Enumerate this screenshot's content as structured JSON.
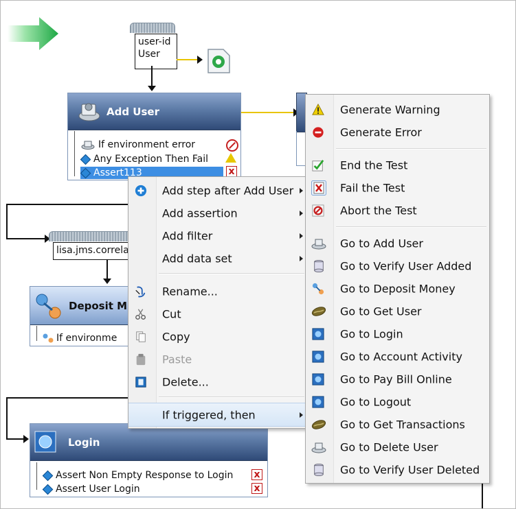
{
  "workflow": {
    "dataset_top": {
      "line1": "user-id",
      "line2": "User"
    },
    "dataset_mid": {
      "label": "lisa.jms.correla"
    },
    "add_user": {
      "title": "Add User",
      "rows": [
        "If environment error",
        "Any Exception Then Fail",
        "Assert113"
      ]
    },
    "deposit": {
      "title": "Deposit M",
      "rows": [
        "If environme"
      ]
    },
    "login": {
      "title": "Login",
      "rows": [
        "Assert Non Empty Response to Login",
        "Assert User Login"
      ]
    }
  },
  "context_menu": {
    "items": [
      {
        "label": "Add step after Add User",
        "icon": "plus-circle-icon",
        "submenu": true
      },
      {
        "label": "Add assertion",
        "icon": "",
        "submenu": true
      },
      {
        "label": "Add filter",
        "icon": "",
        "submenu": true
      },
      {
        "label": "Add data set",
        "icon": "",
        "submenu": true
      },
      {
        "label": "Rename...",
        "icon": "rename-icon",
        "submenu": false
      },
      {
        "label": "Cut",
        "icon": "scissors-icon",
        "submenu": false
      },
      {
        "label": "Copy",
        "icon": "copy-icon",
        "submenu": false
      },
      {
        "label": "Paste",
        "icon": "paste-icon",
        "submenu": false,
        "disabled": true
      },
      {
        "label": "Delete...",
        "icon": "trash-icon",
        "submenu": false
      },
      {
        "label": "If triggered, then",
        "icon": "",
        "submenu": true,
        "highlighted": true
      }
    ]
  },
  "submenu": {
    "items": [
      {
        "label": "Generate Warning",
        "icon": "warning-icon"
      },
      {
        "label": "Generate Error",
        "icon": "error-icon"
      },
      {
        "label": "End the Test",
        "icon": "check-icon"
      },
      {
        "label": "Fail the Test",
        "icon": "fail-icon"
      },
      {
        "label": "Abort the Test",
        "icon": "abort-icon"
      },
      {
        "label": "Go to Add User",
        "icon": "step-icon"
      },
      {
        "label": "Go to Verify User Added",
        "icon": "db-icon"
      },
      {
        "label": "Go to Deposit Money",
        "icon": "deposit-icon"
      },
      {
        "label": "Go to Get User",
        "icon": "bean-icon"
      },
      {
        "label": "Go to Login",
        "icon": "web-icon"
      },
      {
        "label": "Go to Account Activity",
        "icon": "web-icon"
      },
      {
        "label": "Go to Pay Bill Online",
        "icon": "web-icon"
      },
      {
        "label": "Go to Logout",
        "icon": "web-icon"
      },
      {
        "label": "Go to Get Transactions",
        "icon": "bean-icon"
      },
      {
        "label": "Go to Delete User",
        "icon": "step-icon"
      },
      {
        "label": "Go to Verify User Deleted",
        "icon": "db-icon"
      }
    ]
  },
  "colors": {
    "header_dark": "#3a5582",
    "selection": "#3d8ee3",
    "start_arrow": "#27b34a",
    "connector_yellow": "#e8c400"
  }
}
